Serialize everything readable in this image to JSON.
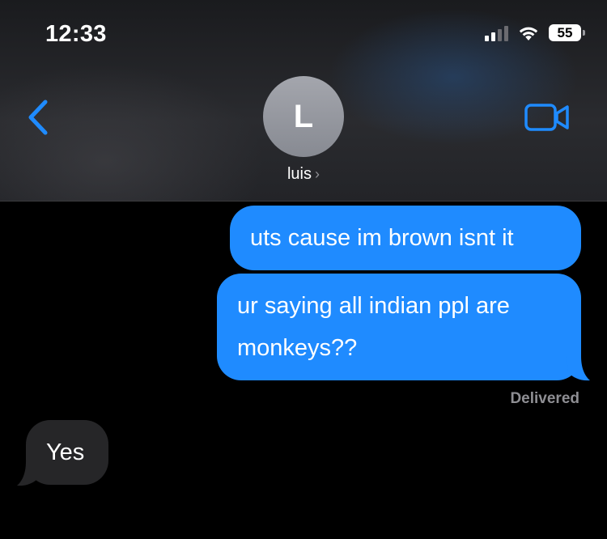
{
  "status_bar": {
    "time": "12:33",
    "battery": "55",
    "signal_bars": 2,
    "signal_bars_total": 4
  },
  "header": {
    "avatar_initial": "L",
    "contact_name": "luis",
    "chevron": "›",
    "back_icon": "chevron-left-icon",
    "video_icon": "video-camera-icon",
    "accent_color": "#1f8bff"
  },
  "messages": [
    {
      "direction": "outgoing",
      "text": "uts cause im brown isnt it"
    },
    {
      "direction": "outgoing",
      "text": "ur saying all indian ppl are monkeys??"
    },
    {
      "direction": "incoming",
      "text": "Yes"
    }
  ],
  "delivery_status": "Delivered",
  "colors": {
    "outgoing_bubble": "#1f8bff",
    "incoming_bubble": "#262628",
    "background": "#000000"
  }
}
